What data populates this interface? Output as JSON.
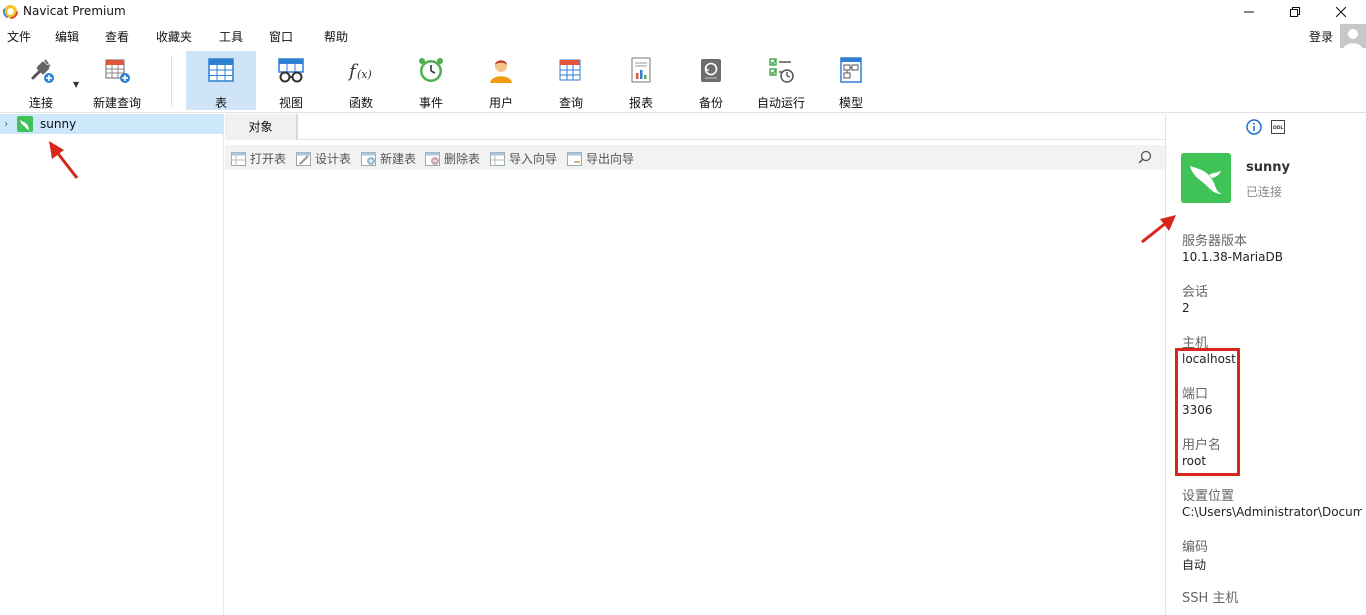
{
  "window": {
    "title": "Navicat Premium"
  },
  "menu": {
    "items": [
      "文件",
      "编辑",
      "查看",
      "收藏夹",
      "工具",
      "窗口",
      "帮助"
    ],
    "login": "登录"
  },
  "toolbar": {
    "connect": "连接",
    "new_query": "新建查询",
    "table": "表",
    "view": "视图",
    "function": "函数",
    "event": "事件",
    "user": "用户",
    "query": "查询",
    "report": "报表",
    "backup": "备份",
    "automation": "自动运行",
    "model": "模型",
    "active": "表"
  },
  "navigator": {
    "connection": "sunny"
  },
  "tabs": {
    "objects": "对象"
  },
  "object_toolbar": {
    "open_table": "打开表",
    "design_table": "设计表",
    "new_table": "新建表",
    "delete_table": "删除表",
    "import_wizard": "导入向导",
    "export_wizard": "导出向导"
  },
  "info_panel": {
    "name": "sunny",
    "status": "已连接",
    "fields": [
      {
        "label": "服务器版本",
        "value": "10.1.38-MariaDB"
      },
      {
        "label": "会话",
        "value": "2"
      },
      {
        "label": "主机",
        "value": "localhost"
      },
      {
        "label": "端口",
        "value": "3306"
      },
      {
        "label": "用户名",
        "value": "root"
      },
      {
        "label": "设置位置",
        "value": "C:\\Users\\Administrator\\Documents"
      },
      {
        "label": "编码",
        "value": "自动"
      },
      {
        "label": "SSH 主机",
        "value": ""
      }
    ]
  },
  "colors": {
    "accent": "#3fc256",
    "selection": "#cde8fb",
    "annotation": "#d9261c"
  }
}
